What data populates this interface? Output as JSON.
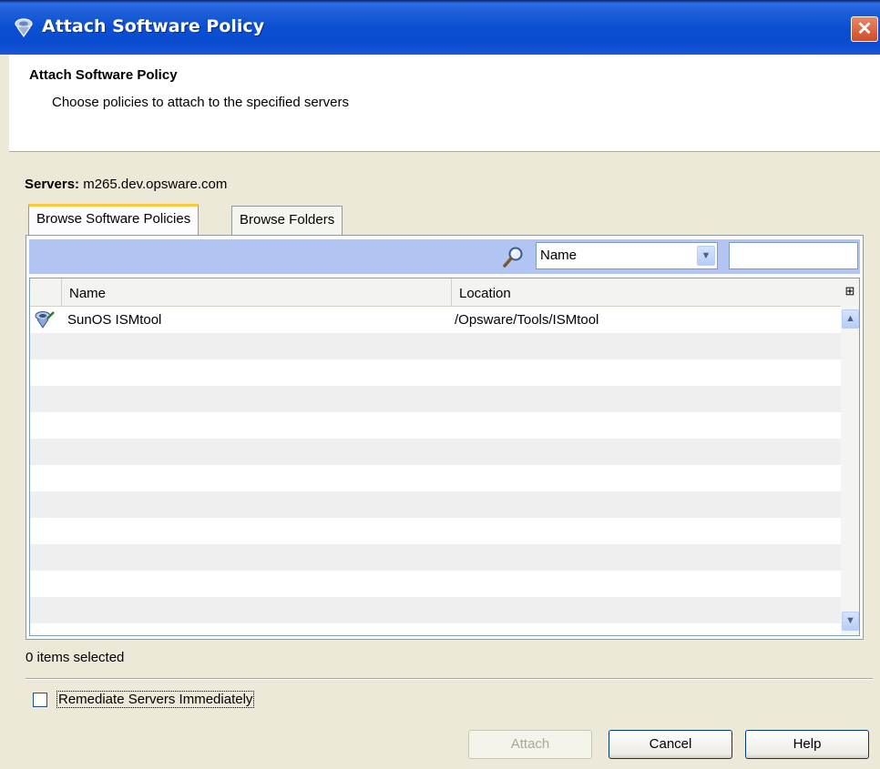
{
  "window": {
    "title": "Attach Software Policy",
    "close_label": "✕"
  },
  "header": {
    "title": "Attach Software Policy",
    "subtitle": "Choose policies to attach to the specified servers"
  },
  "servers": {
    "label": "Servers:",
    "value": "m265.dev.opsware.com"
  },
  "tabs": [
    {
      "label": "Browse Software Policies",
      "active": true
    },
    {
      "label": "Browse Folders",
      "active": false
    }
  ],
  "filter": {
    "field_selected": "Name",
    "search_value": ""
  },
  "table": {
    "columns": [
      "Name",
      "Location"
    ],
    "rows": [
      {
        "name": "SunOS ISMtool",
        "location": "/Opsware/Tools/ISMtool",
        "icon": "software-policy-icon"
      }
    ]
  },
  "status": {
    "selection_text": "0 items selected"
  },
  "options": {
    "remediate_label": "Remediate Servers Immediately",
    "remediate_checked": false
  },
  "buttons": {
    "attach": "Attach",
    "cancel": "Cancel",
    "help": "Help"
  },
  "icons": {
    "title": "software-policy-icon",
    "search": "search-icon",
    "dropdown": "chevron-down-icon",
    "column_chooser": "column-chooser-icon",
    "scroll_up": "scroll-up-icon",
    "scroll_down": "scroll-down-icon"
  },
  "colors": {
    "titlebar": "#0b4fd2",
    "filterbar": "#b1c4f2",
    "tab_highlight": "#ffc83c",
    "close": "#d14b24"
  }
}
